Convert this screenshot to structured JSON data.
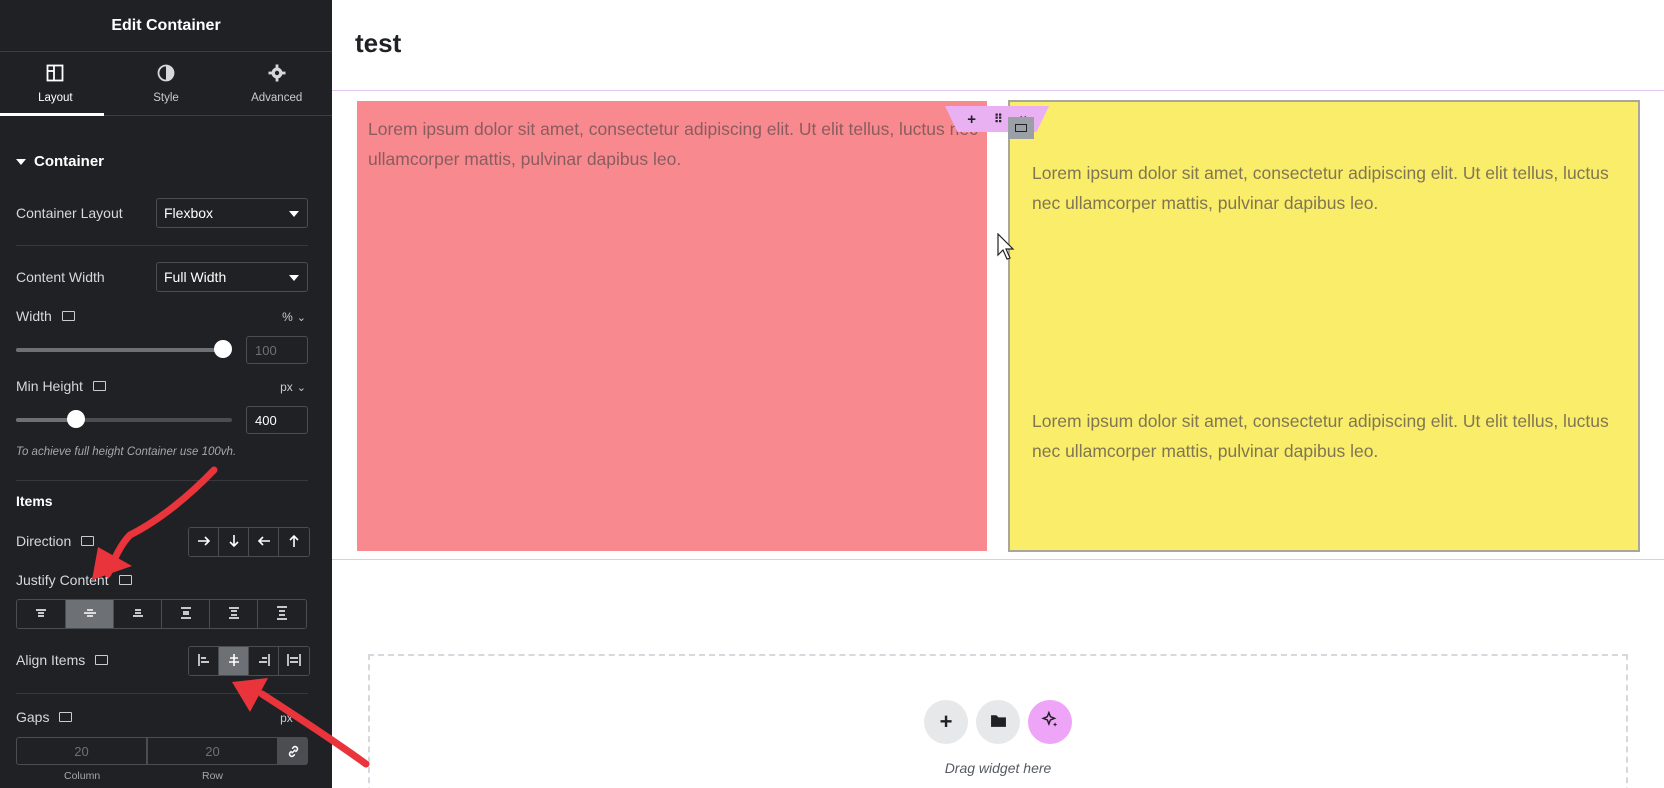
{
  "panel": {
    "title": "Edit Container",
    "tabs": [
      {
        "label": "Layout",
        "icon": "layout-icon",
        "active": true
      },
      {
        "label": "Style",
        "icon": "contrast-icon",
        "active": false
      },
      {
        "label": "Advanced",
        "icon": "gear-icon",
        "active": false
      }
    ],
    "section_title": "Container",
    "container_layout": {
      "label": "Container Layout",
      "value": "Flexbox"
    },
    "content_width": {
      "label": "Content Width",
      "value": "Full Width"
    },
    "width": {
      "label": "Width",
      "unit": "%",
      "placeholder": "100",
      "slider_fraction": 1.0
    },
    "min_height": {
      "label": "Min Height",
      "unit": "px",
      "value": "400",
      "slider_fraction": 0.26
    },
    "hint": "To achieve full height Container use 100vh.",
    "items_heading": "Items",
    "direction": {
      "label": "Direction",
      "options": [
        "row-icon",
        "column-icon",
        "row-reverse-icon",
        "column-reverse-icon"
      ]
    },
    "justify_content": {
      "label": "Justify Content",
      "options": [
        "start",
        "center",
        "end",
        "space-between",
        "space-around",
        "space-evenly"
      ],
      "active": "center"
    },
    "align_items": {
      "label": "Align Items",
      "options": [
        "start",
        "center",
        "end",
        "stretch"
      ],
      "active": "center"
    },
    "gaps": {
      "label": "Gaps",
      "unit": "px",
      "column_placeholder": "20",
      "row_placeholder": "20",
      "column_caption": "Column",
      "row_caption": "Row"
    }
  },
  "canvas": {
    "page_title": "test",
    "red_text": "Lorem ipsum dolor sit amet, consectetur adipiscing elit. Ut elit tellus, luctus nec ullamcorper mattis, pulvinar dapibus leo.",
    "yellow_text_1": "Lorem ipsum dolor sit amet, consectetur adipiscing elit. Ut elit tellus, luctus nec ullamcorper mattis, pulvinar dapibus leo.",
    "yellow_text_2": "Lorem ipsum dolor sit amet, consectetur adipiscing elit. Ut elit tellus, luctus nec ullamcorper mattis, pulvinar dapibus leo.",
    "dropzone_caption": "Drag widget here",
    "colors": {
      "red_box": "#f88a8f",
      "yellow_box": "#f9ed69",
      "accent_pink": "#e9b1f2",
      "annotation_arrow": "#e8343a"
    }
  }
}
